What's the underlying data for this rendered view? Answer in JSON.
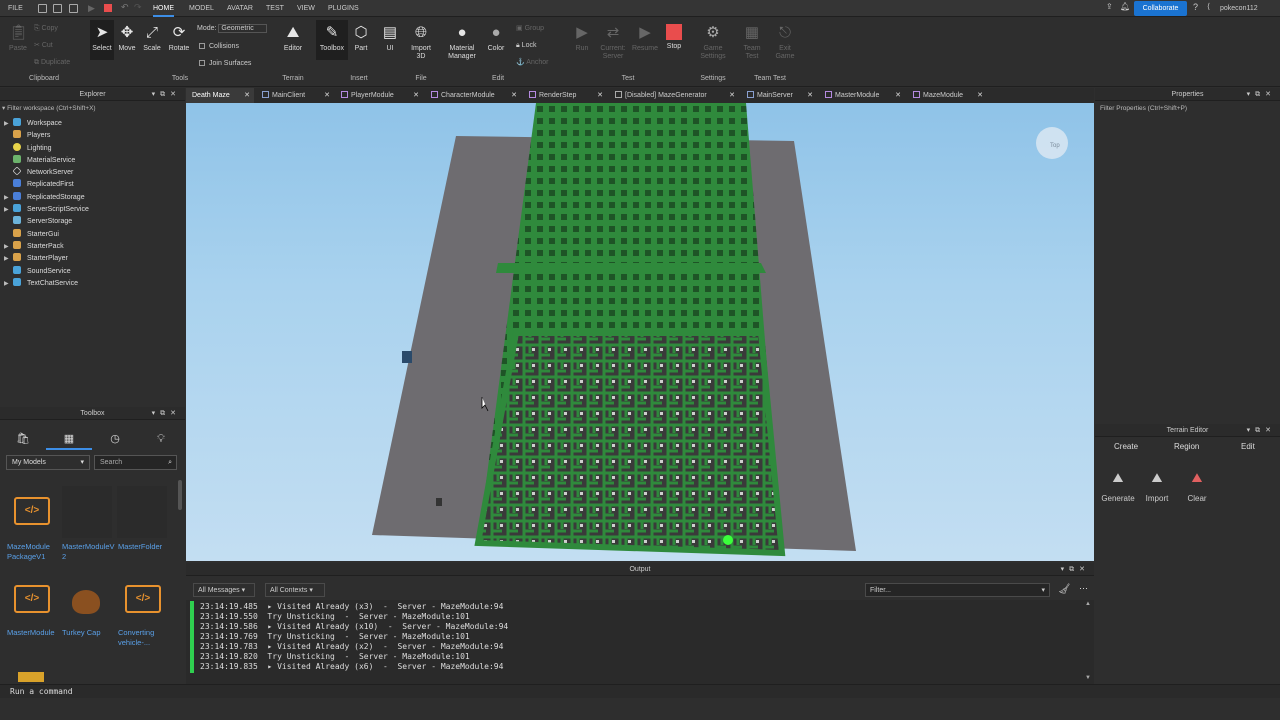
{
  "menu": {
    "file": "FILE",
    "tabs": [
      "HOME",
      "MODEL",
      "AVATAR",
      "TEST",
      "VIEW",
      "PLUGINS"
    ],
    "collaborate": "Collaborate",
    "username": "pokecon112"
  },
  "ribbon": {
    "clipboard": {
      "paste": "Paste",
      "copy": "Copy",
      "cut": "Cut",
      "duplicate": "Duplicate",
      "group": "Clipboard"
    },
    "tools": {
      "select": "Select",
      "move": "Move",
      "scale": "Scale",
      "rotate": "Rotate",
      "mode_label": "Mode:",
      "mode_value": "Geometric",
      "collisions": "Collisions",
      "join": "Join Surfaces",
      "group": "Tools"
    },
    "terrain": {
      "editor": "Editor",
      "group": "Terrain"
    },
    "insert": {
      "toolbox": "Toolbox",
      "part": "Part",
      "ui": "UI",
      "group": "Insert"
    },
    "file": {
      "import3d": "Import 3D",
      "group": "File"
    },
    "edit": {
      "material": "Material Manager",
      "color": "Color",
      "group_btn": "Group",
      "lock": "Lock",
      "anchor": "Anchor",
      "group": "Edit"
    },
    "test": {
      "run": "Run",
      "client_server": "Current: Server",
      "resume": "Resume",
      "stop": "Stop",
      "group": "Test"
    },
    "settings": {
      "game": "Game Settings",
      "group": "Settings"
    },
    "teamtest": {
      "team": "Team Test",
      "exit": "Exit Game",
      "group": "Team Test"
    }
  },
  "script_tabs": [
    "Death Maze",
    "MainClient",
    "PlayerModule",
    "CharacterModule",
    "RenderStep",
    "[Disabled] MazeGenerator",
    "MainServer",
    "MasterModule",
    "MazeModule"
  ],
  "explorer": {
    "title": "Explorer",
    "filter": "Filter workspace (Ctrl+Shift+X)",
    "items": [
      "Workspace",
      "Players",
      "Lighting",
      "MaterialService",
      "NetworkServer",
      "ReplicatedFirst",
      "ReplicatedStorage",
      "ServerScriptService",
      "ServerStorage",
      "StarterGui",
      "StarterPack",
      "StarterPlayer",
      "SoundService",
      "TextChatService"
    ]
  },
  "toolbox": {
    "title": "Toolbox",
    "category": "My Models",
    "search_placeholder": "Search",
    "items": [
      "MazeModule PackageV1",
      "MasterModuleV2",
      "MasterFolder",
      "MasterModule",
      "Turkey Cap",
      "Converting vehicle-..."
    ]
  },
  "properties": {
    "title": "Properties",
    "filter": "Filter Properties (Ctrl+Shift+P)"
  },
  "terrain_editor": {
    "title": "Terrain Editor",
    "tabs": [
      "Create",
      "Region",
      "Edit"
    ],
    "buttons": [
      "Generate",
      "Import",
      "Clear"
    ]
  },
  "output": {
    "title": "Output",
    "messages_filter": "All Messages",
    "contexts_filter": "All Contexts",
    "filter_placeholder": "Filter...",
    "lines": [
      "23:14:19.485  ▸ Visited Already (x3)  -  Server - MazeModule:94",
      "23:14:19.550  Try Unsticking  -  Server - MazeModule:101",
      "23:14:19.586  ▸ Visited Already (x10)  -  Server - MazeModule:94",
      "23:14:19.769  Try Unsticking  -  Server - MazeModule:101",
      "23:14:19.783  ▸ Visited Already (x2)  -  Server - MazeModule:94",
      "23:14:19.820  Try Unsticking  -  Server - MazeModule:101",
      "23:14:19.835  ▸ Visited Already (x6)  -  Server - MazeModule:94"
    ]
  },
  "command_bar": {
    "placeholder": "Run a command"
  },
  "colors": {
    "accent": "#3d8ee6",
    "maze_green": "#2e8a3a",
    "floor": "#6e6c70",
    "stop": "#e94d4d"
  }
}
